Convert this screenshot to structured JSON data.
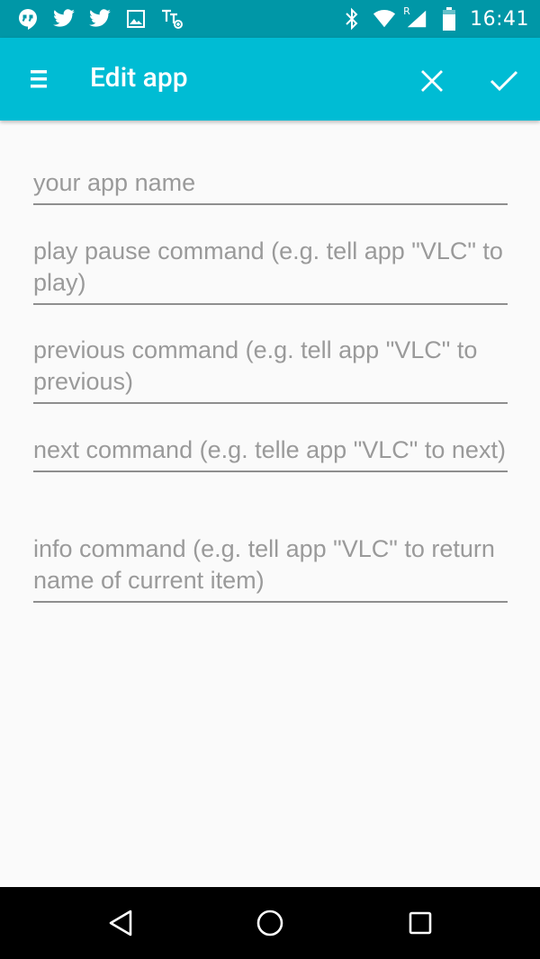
{
  "status_bar": {
    "time": "16:41",
    "left_icons": [
      "hangouts-icon",
      "twitter-icon",
      "twitter-icon",
      "image-icon",
      "tts-icon"
    ],
    "right_icons": [
      "bluetooth-icon",
      "wifi-icon",
      "signal-roaming-icon",
      "battery-icon"
    ],
    "roaming_letter": "R"
  },
  "toolbar": {
    "title": "Edit app",
    "background": "#00bcd4"
  },
  "form": {
    "fields": [
      {
        "placeholder": "your app name"
      },
      {
        "placeholder": "play pause command (e.g. tell app \"VLC\" to play)"
      },
      {
        "placeholder": "previous command (e.g. tell app \"VLC\" to previous)"
      },
      {
        "placeholder": "next command (e.g. telle app \"VLC\" to next)"
      },
      {
        "placeholder": "info command (e.g. tell app \"VLC\" to return name of current item)"
      }
    ]
  }
}
